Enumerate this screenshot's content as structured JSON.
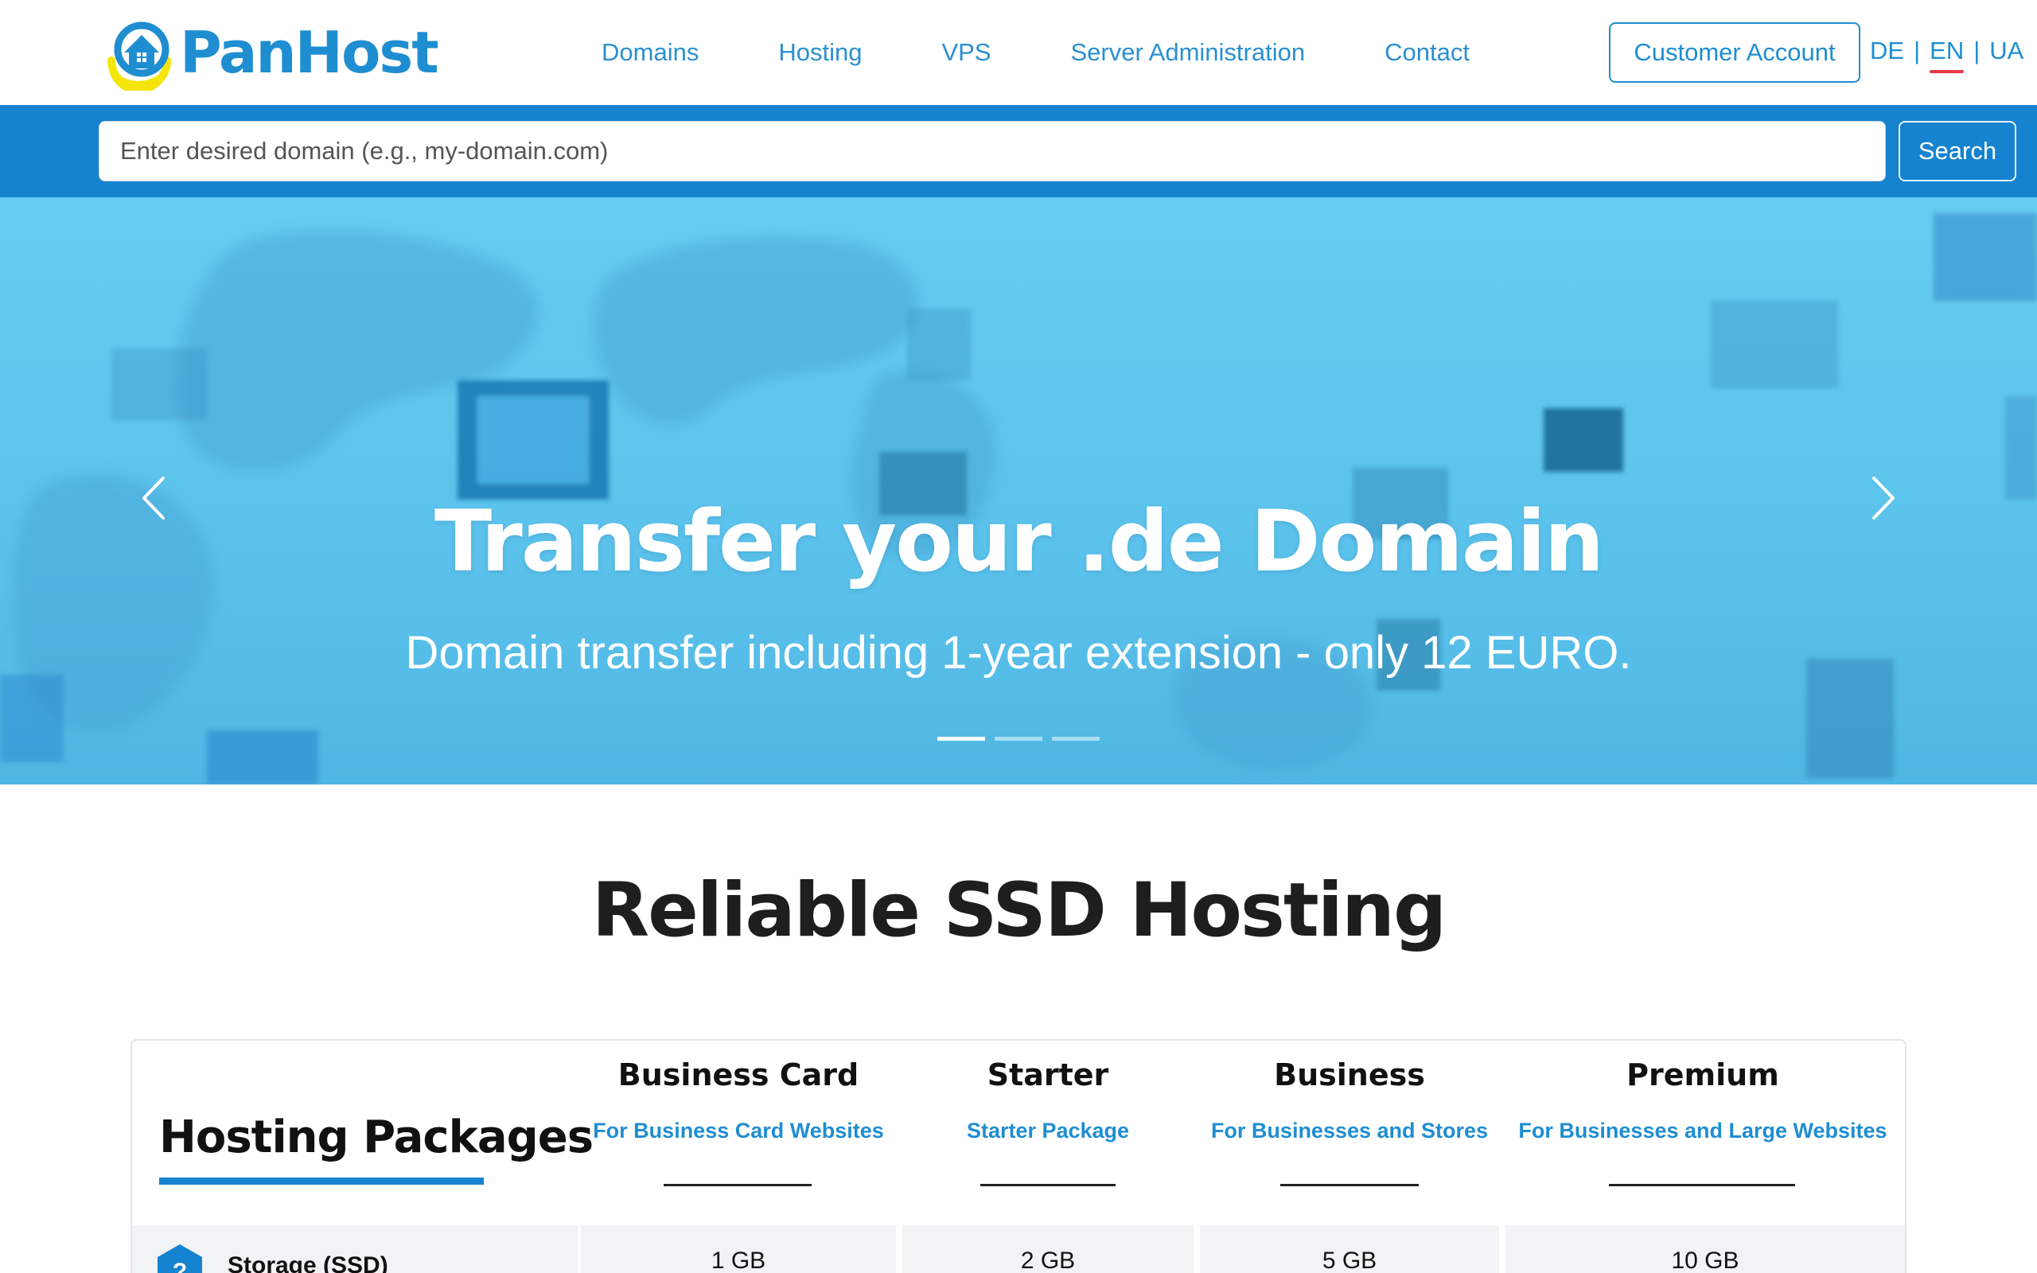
{
  "brand": {
    "name": "PanHost",
    "colors": {
      "primary": "#1583cf",
      "logo_yellow": "#f5e50a",
      "accent_red": "#e63946"
    }
  },
  "nav": {
    "items": [
      {
        "label": "Domains"
      },
      {
        "label": "Hosting"
      },
      {
        "label": "VPS"
      },
      {
        "label": "Server Administration"
      },
      {
        "label": "Contact"
      }
    ],
    "account_label": "Customer Account",
    "languages": [
      {
        "code": "DE",
        "active": false
      },
      {
        "code": "EN",
        "active": true
      },
      {
        "code": "UA",
        "active": false
      }
    ]
  },
  "search": {
    "placeholder": "Enter desired domain (e.g., my-domain.com)",
    "button_label": "Search"
  },
  "hero": {
    "title": "Transfer your .de Domain",
    "subtitle": "Domain transfer including 1-year extension - only 12 EURO.",
    "prev_icon": "chevron-left-icon",
    "next_icon": "chevron-right-icon",
    "slides_total": 3,
    "active_slide": 1
  },
  "section": {
    "title": "Reliable SSD Hosting"
  },
  "packages": {
    "heading": "Hosting Packages",
    "columns": [
      {
        "name": "Business Card",
        "description": "For Business Card Websites"
      },
      {
        "name": "Starter",
        "description": "Starter Package"
      },
      {
        "name": "Business",
        "description": "For Businesses and Stores"
      },
      {
        "name": "Premium",
        "description": "For Businesses and Large Websites"
      }
    ],
    "rows": [
      {
        "label": "Storage (SSD)",
        "help_icon": "question-hexagon-icon",
        "values": [
          "1 GB",
          "2 GB",
          "5 GB",
          "10 GB"
        ]
      }
    ]
  }
}
